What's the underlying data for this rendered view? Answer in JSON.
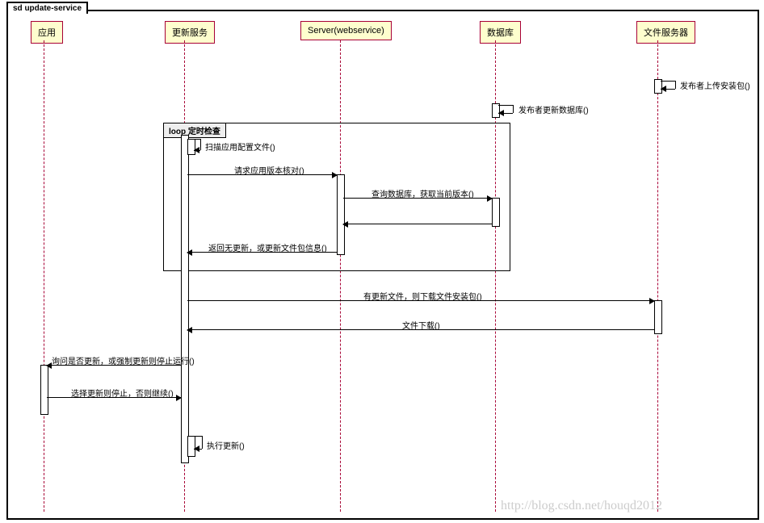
{
  "frame": {
    "label": "sd update-service"
  },
  "participants": {
    "p1": "应用",
    "p2": "更新服务",
    "p3": "Server(webservice)",
    "p4": "数据库",
    "p5": "文件服务器"
  },
  "loop": {
    "label": "loop",
    "condition": "定时检查"
  },
  "messages": {
    "m1": "发布者上传安装包()",
    "m2": "发布者更新数据库()",
    "m3": "扫描应用配置文件()",
    "m4": "请求应用版本核对()",
    "m5": "查询数据库，获取当前版本()",
    "m6": "",
    "m7": "返回无更新，或更新文件包信息()",
    "m8": "有更新文件，则下载文件安装包()",
    "m9": "文件下载()",
    "m10": "询问是否更新，或强制更新则停止运行()",
    "m11": "选择更新则停止，否则继续()",
    "m12": "执行更新()"
  },
  "watermark": "http://blog.csdn.net/houqd2012"
}
